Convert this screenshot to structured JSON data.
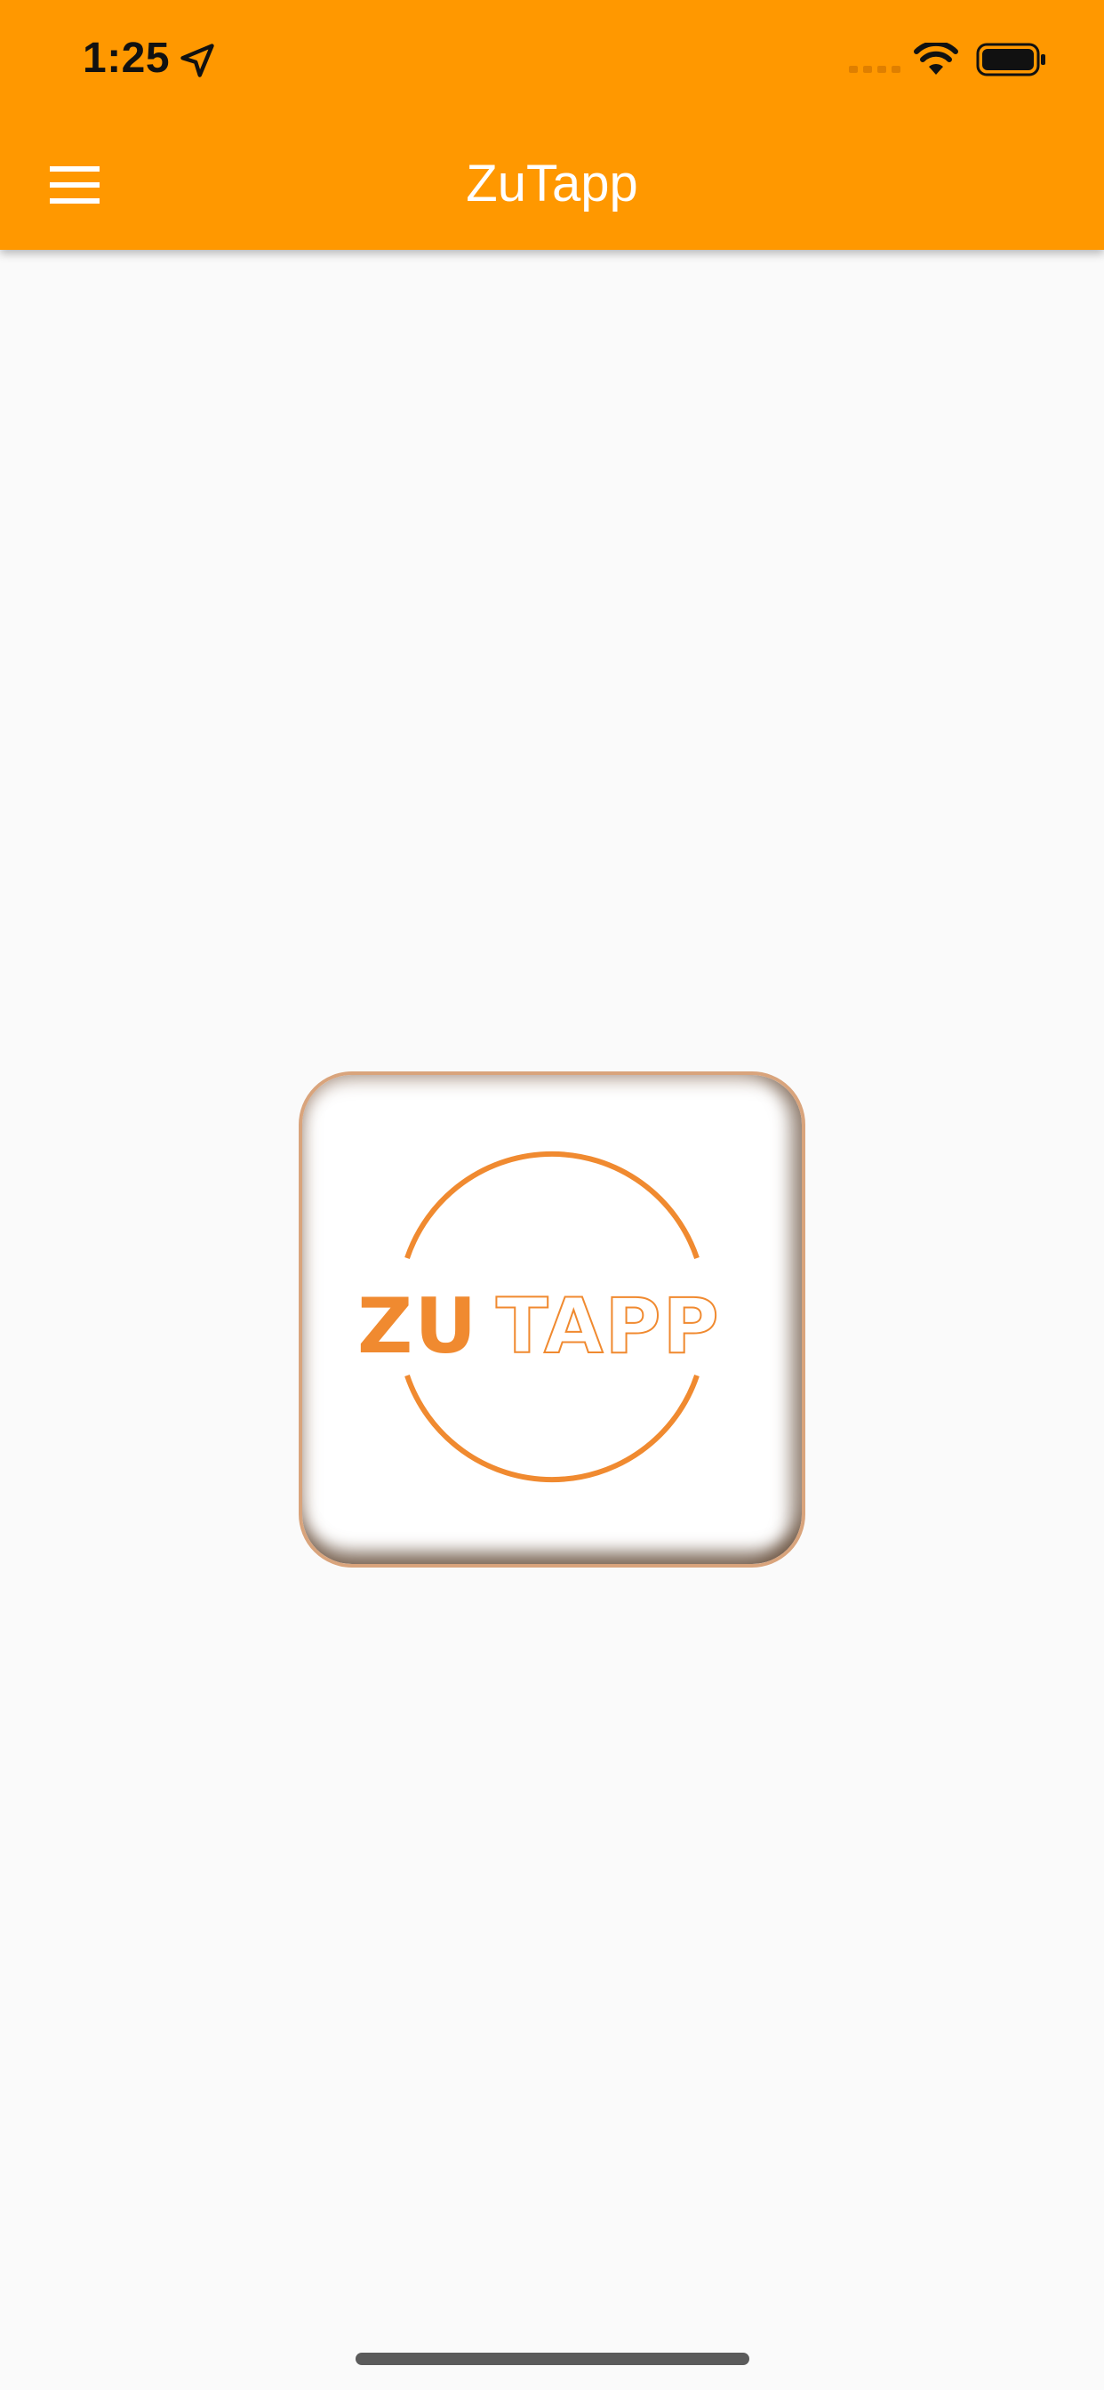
{
  "status_bar": {
    "time": "1:25",
    "icons": [
      "location-arrow-icon",
      "cellular-signal-icon",
      "wifi-icon",
      "battery-icon"
    ]
  },
  "app_bar": {
    "title": "ZuTapp",
    "menu_icon": "hamburger-menu-icon",
    "background_color": "#ff9800",
    "title_color": "#ffffff"
  },
  "logo": {
    "text": "ZUTAPP",
    "brand_color": "#f08a30",
    "tile_border_color": "#d9a47c"
  },
  "page": {
    "background_color": "#fafafa"
  }
}
